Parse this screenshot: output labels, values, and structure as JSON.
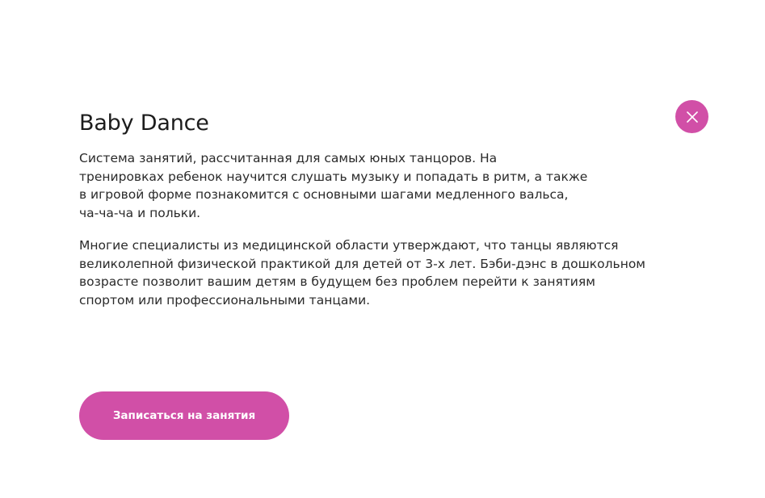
{
  "modal": {
    "title": "Baby Dance",
    "paragraph1_lines": [
      "Система занятий, рассчитанная для самых юных танцоров. На",
      "тренировках ребенок научится слушать музыку и попадать в ритм, а также",
      "в игровой форме познакомится с основными шагами медленного вальса,",
      "ча-ча-ча и польки."
    ],
    "paragraph2_lines": [
      "Многие специалисты из медицинской области утверждают, что танцы являются",
      "великолепной физической практикой для детей от 3-х лет. Бэби-дэнс в дошкольном",
      "возрасте позволит вашим детям в будущем без проблем перейти к занятиям",
      "спортом или профессиональными танцами."
    ],
    "cta_label": "Записаться на занятия",
    "close_icon": "close-icon"
  },
  "colors": {
    "accent": "#d14fa7",
    "text": "#2a2a2a",
    "background": "#ffffff"
  }
}
